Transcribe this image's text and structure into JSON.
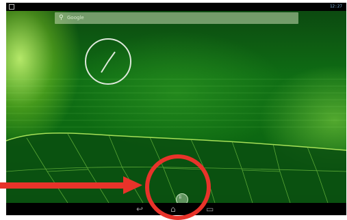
{
  "status_bar": {
    "time": "12:27"
  },
  "search": {
    "label": "Google"
  },
  "dock": {
    "apps_icon": "all-apps-icon"
  },
  "nav": {
    "back_icon": "back-icon",
    "home_icon": "home-icon",
    "recents_icon": "recents-icon"
  },
  "annotation": {
    "arrow_color": "#e8332a",
    "circle_color": "#e8332a"
  }
}
